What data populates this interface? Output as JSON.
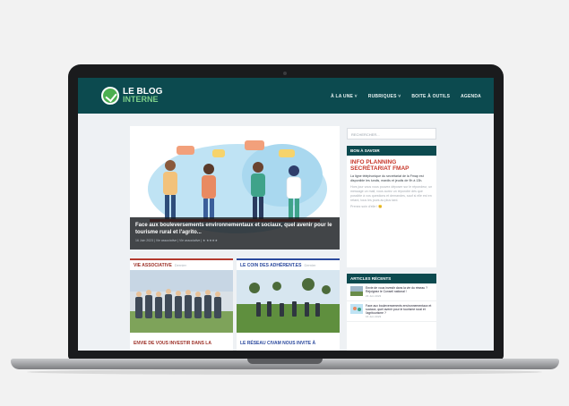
{
  "header": {
    "logo_line1": "LE BLOG",
    "logo_line2": "INTERNE",
    "nav": [
      "À LA UNE ˅",
      "RUBRIQUES ˅",
      "BOITE À OUTILS",
      "AGENDA"
    ]
  },
  "hero": {
    "title": "Face aux bouleversements environnementaux et sociaux, quel avenir pour le tourisme rural et l'agrito...",
    "meta": "16 Juin 2023 | Vie associative | Vie associative | ★ ★★★★"
  },
  "cards": [
    {
      "category": "VIE ASSOCIATIVE",
      "sub": "Dernier",
      "title": "ENVIE DE VOUS INVESTIR DANS LA"
    },
    {
      "category": "LE COIN DES ADHÉRENT.ES",
      "sub": "Dernier",
      "title": "LE RÉSEAU CIVAM NOUS INVITE À"
    }
  ],
  "sidebar": {
    "search_placeholder": "RECHERCHER...",
    "bon_a_savoir": {
      "heading": "BON À SAVOIR",
      "title": "INFO PLANNING SECRÉTARIAT FMAP",
      "body": "La ligne téléphonique du secrétariat de la Fmap est disponible les lundis, mardis et jeudis de 9h à 13h.",
      "faded": "Hors jour vous vous pouvez déposer sur le répondeur, un message un mail, vous aurez un répondre dès que possible à vos questions et demandes, sauf si elle est en retard, tous les jours au plus tard.",
      "footer": "Prenez soin d'elle ! 😊"
    },
    "recent": {
      "heading": "ARTICLES RÉCENTS",
      "items": [
        {
          "text": "Envie de vous investir dans la vie du réseau ? Rejoignez le Conseil national !",
          "date": "23 Juin 2023"
        },
        {
          "text": "Face aux bouleversements environnementaux et sociaux, quel avenir pour le tourisme rural et l'agritourisme ?",
          "date": "16 Juin 2023"
        }
      ]
    }
  },
  "colors": {
    "header_bg": "#0c4a4f",
    "accent_red": "#c8382b",
    "accent_blue": "#2c4a9e",
    "logo_green": "#7dd08a"
  }
}
